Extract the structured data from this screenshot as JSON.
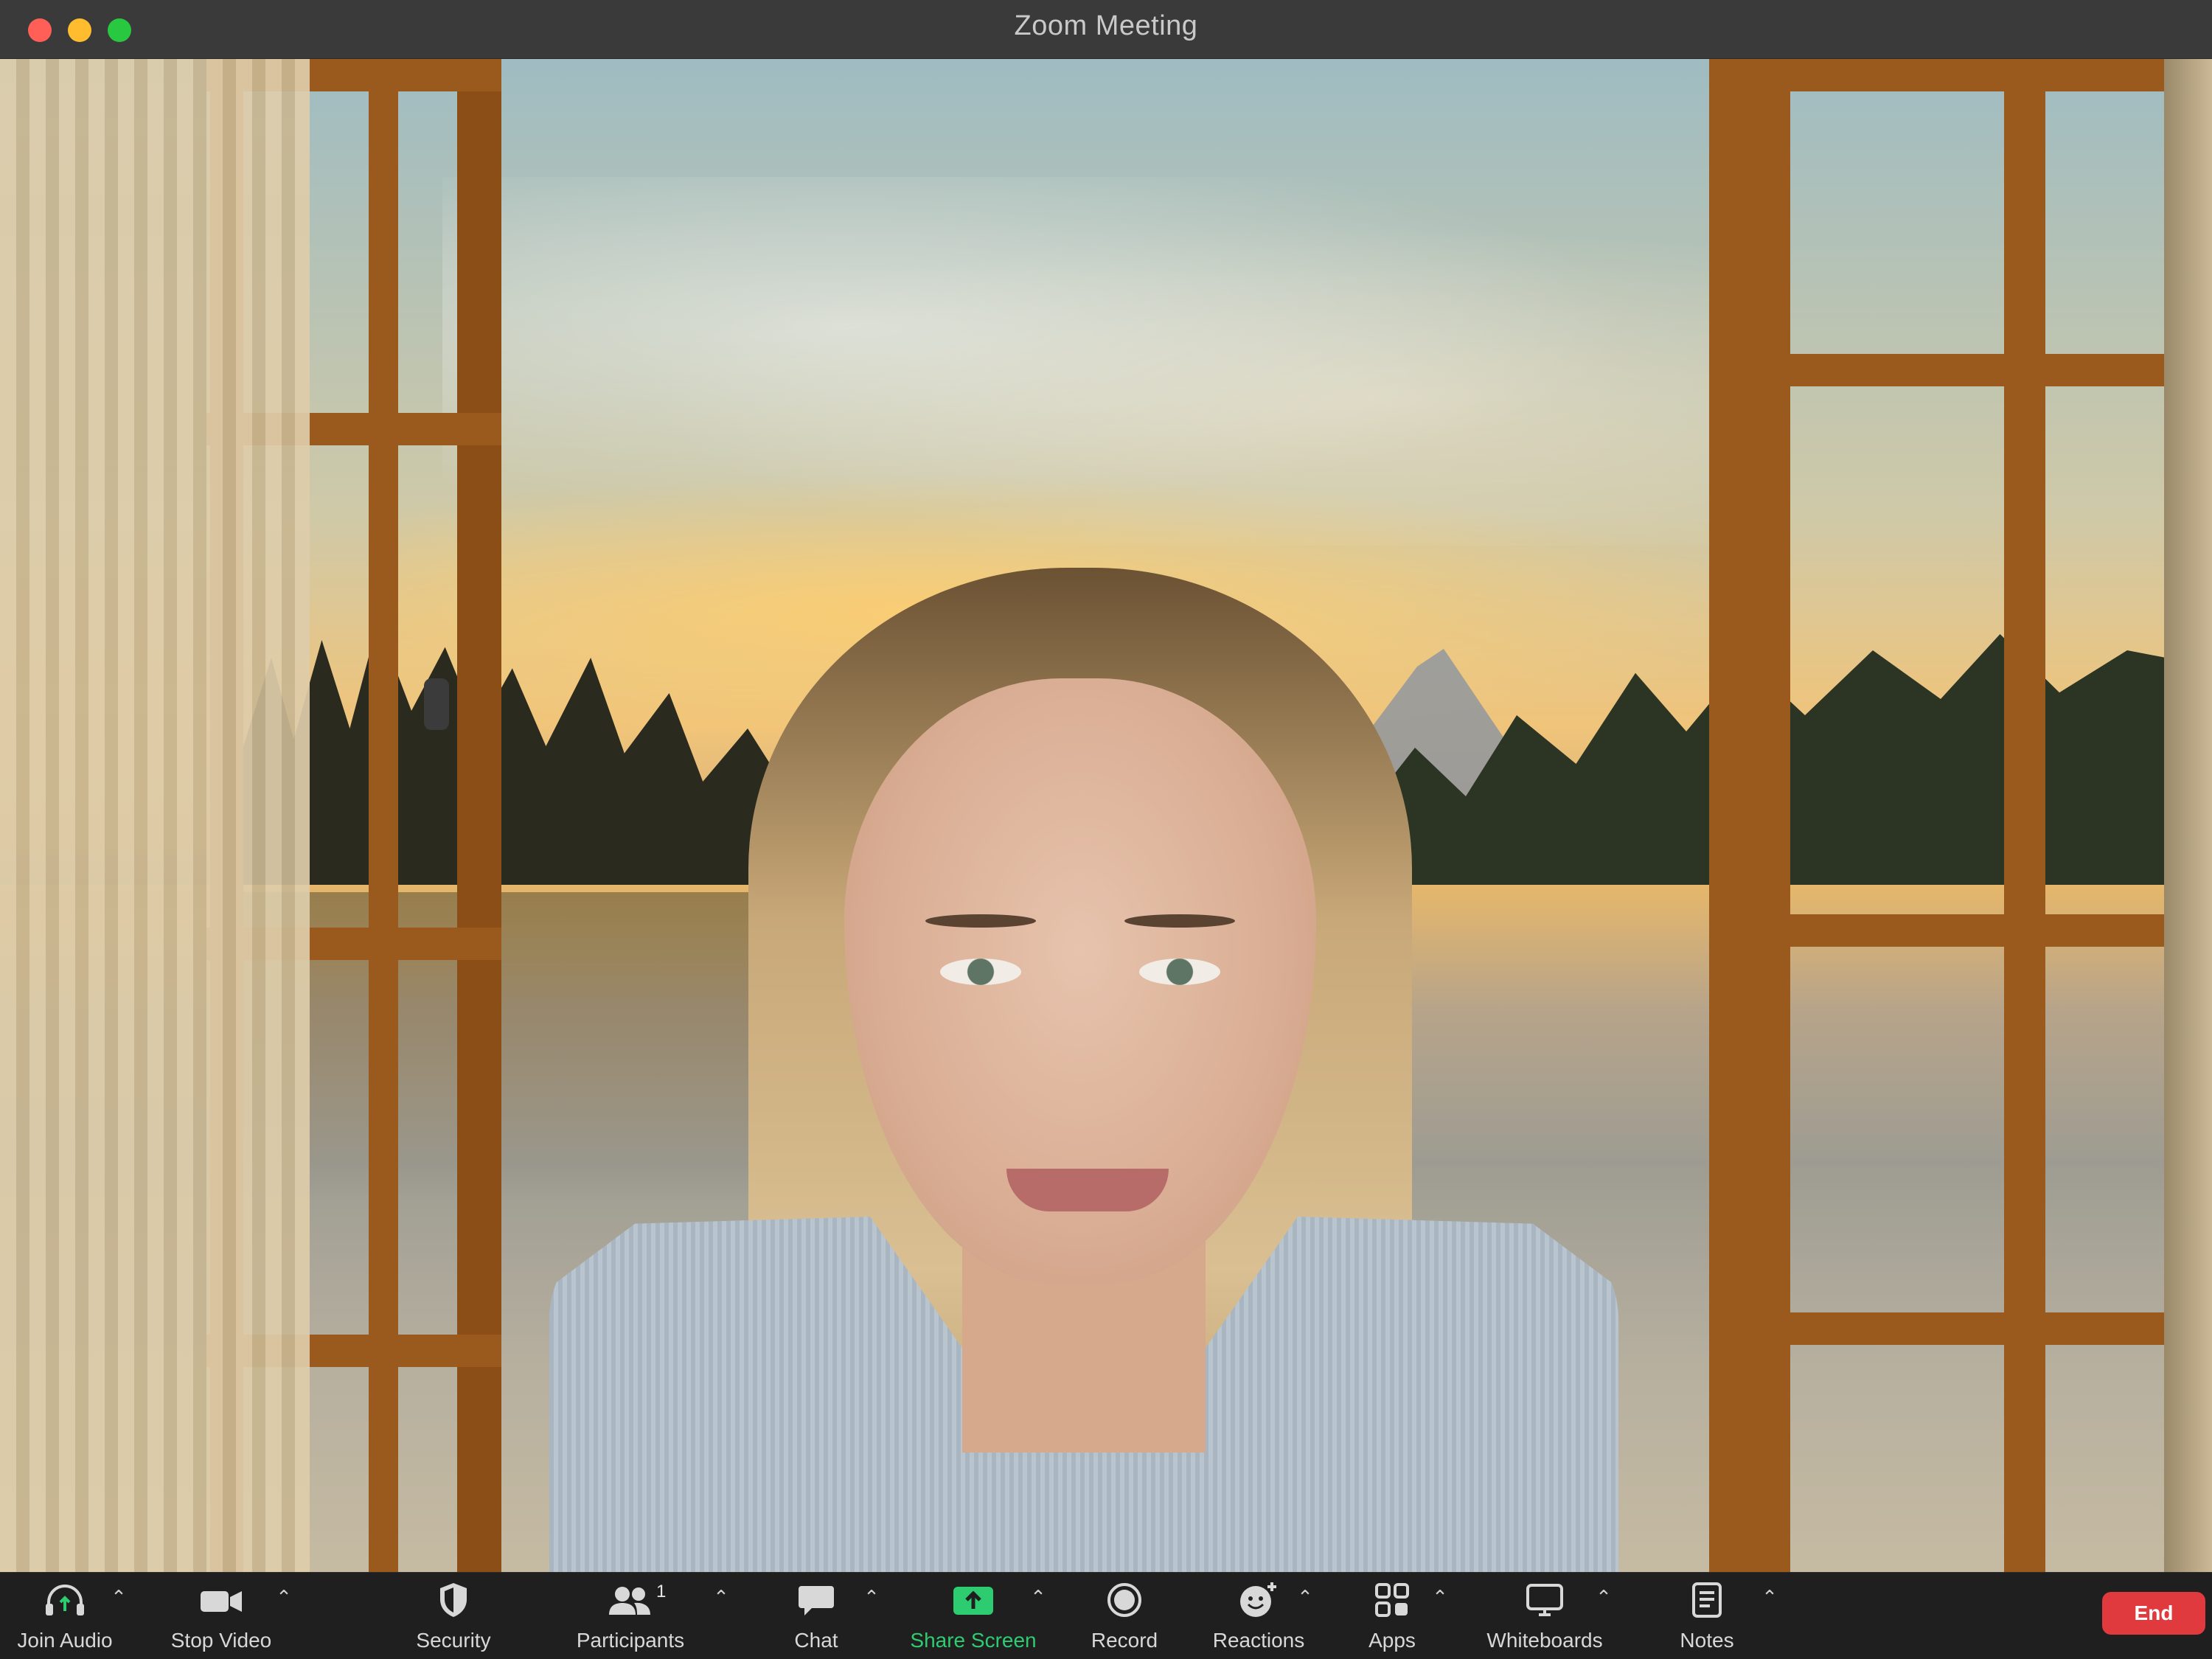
{
  "window": {
    "title": "Zoom Meeting"
  },
  "toolbar": {
    "join_audio": "Join Audio",
    "stop_video": "Stop Video",
    "security": "Security",
    "participants": "Participants",
    "participant_count": "1",
    "chat": "Chat",
    "share_screen": "Share Screen",
    "record": "Record",
    "reactions": "Reactions",
    "apps": "Apps",
    "whiteboards": "Whiteboards",
    "notes": "Notes",
    "end": "End"
  },
  "icons": {
    "join_audio": "headphones-icon",
    "stop_video": "video-camera-icon",
    "security": "shield-icon",
    "participants": "people-icon",
    "chat": "chat-bubble-icon",
    "share_screen": "share-screen-icon",
    "record": "record-icon",
    "reactions": "smiley-plus-icon",
    "apps": "apps-icon",
    "whiteboards": "whiteboard-icon",
    "notes": "notes-icon",
    "caret": "chevron-up-icon"
  },
  "colors": {
    "accent_green": "#2ecc71",
    "end_red": "#e0393e",
    "toolbar_bg": "#1f1f1f",
    "titlebar_bg": "#3a3a3a"
  }
}
